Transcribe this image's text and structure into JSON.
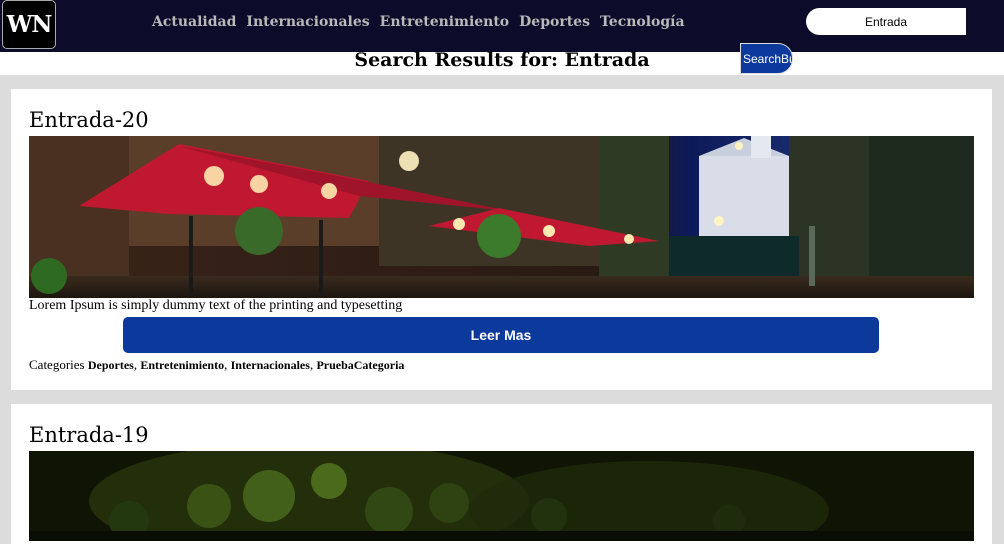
{
  "header": {
    "logo": "WN",
    "nav": [
      "Actualidad",
      "Internacionales",
      "Entretenimiento",
      "Deportes",
      "Tecnología"
    ],
    "search_value": "Entrada",
    "search_button": "SearchBu"
  },
  "results_title": "Search Results for: Entrada",
  "posts": [
    {
      "title": "Entrada-20",
      "excerpt": "Lorem Ipsum is simply dummy text of the printing and typesetting",
      "read_more": "Leer Mas",
      "categories_label": "Categories",
      "categories": [
        "Deportes",
        "Entretenimiento",
        "Internacionales",
        "PruebaCategoria"
      ]
    },
    {
      "title": "Entrada-19"
    }
  ],
  "colors": {
    "header_bg": "#0c0b2a",
    "accent": "#0b3a9c",
    "page_bg": "#dcdcdc"
  }
}
